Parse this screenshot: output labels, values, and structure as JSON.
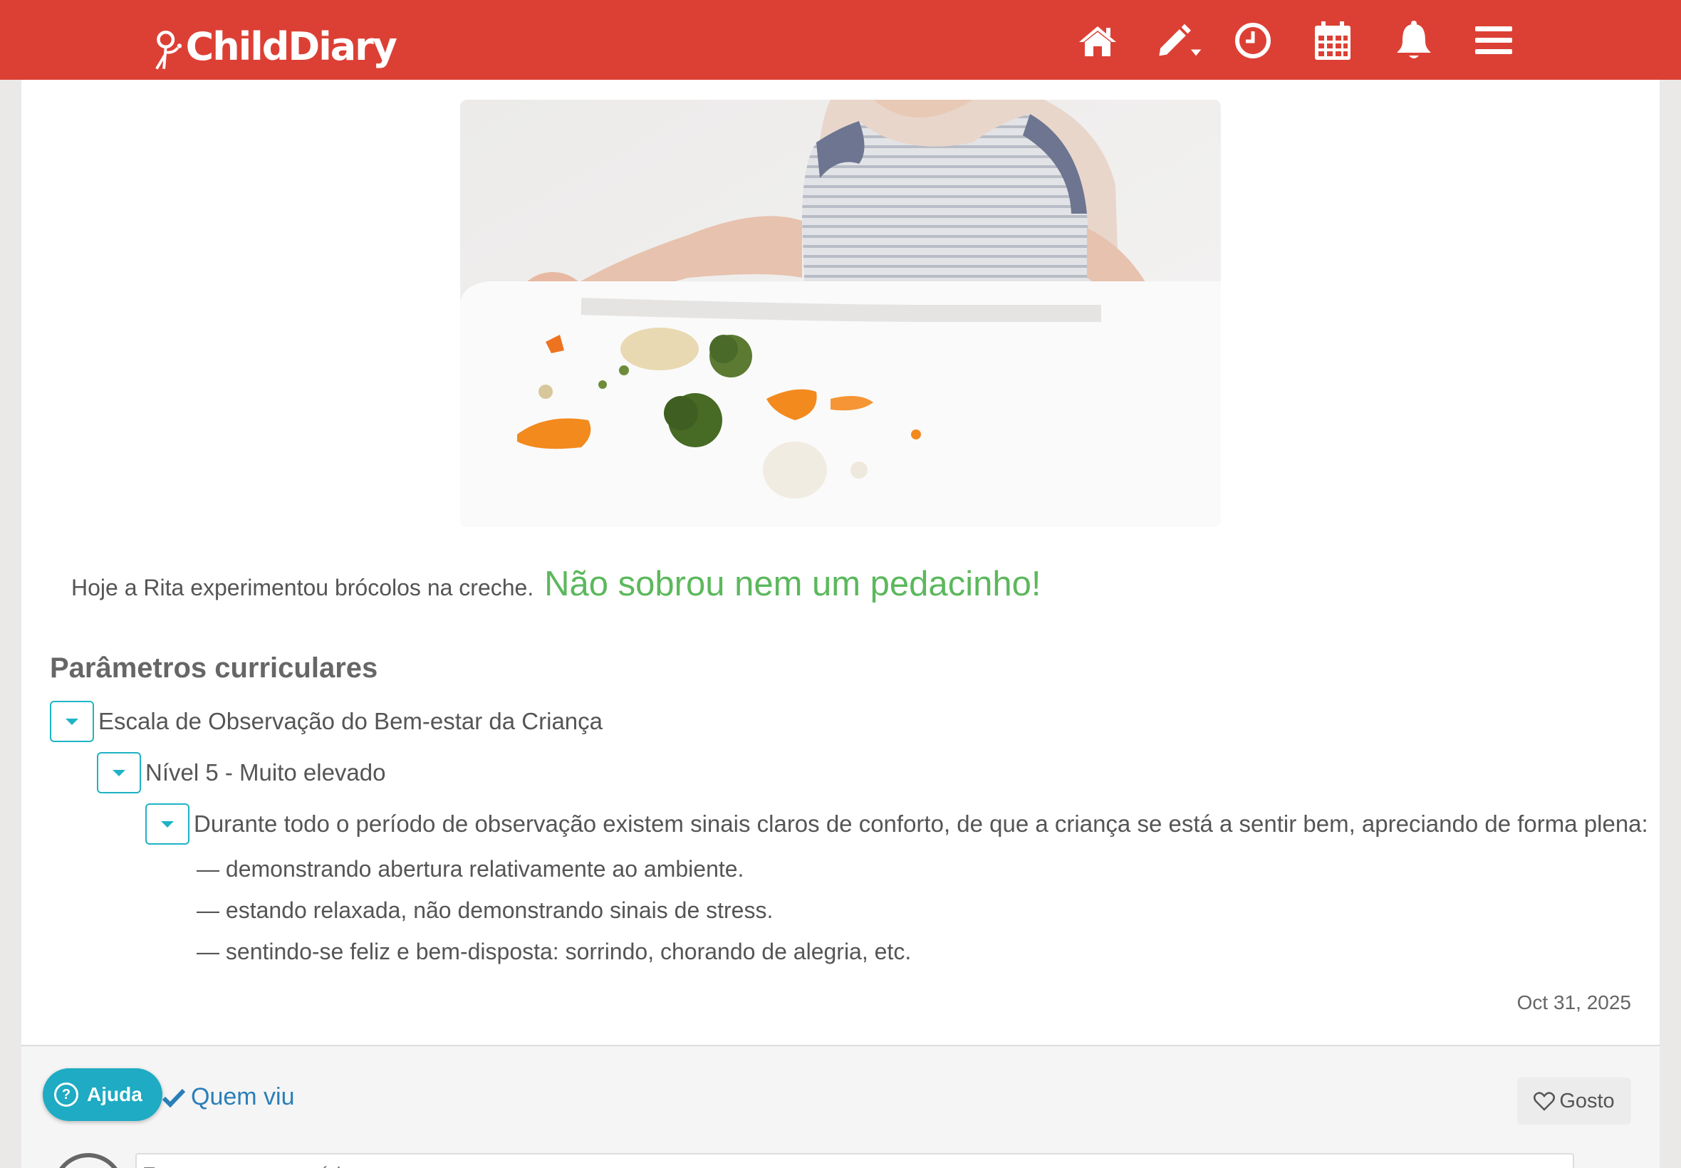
{
  "header": {
    "logo_text": "ChildDiary",
    "nav_icons": [
      "home-icon",
      "edit-icon",
      "clock-icon",
      "calendar-icon",
      "bell-icon",
      "menu-icon"
    ]
  },
  "post": {
    "caption_text": "Hoje a Rita experimentou brócolos na creche.",
    "caption_highlight": "Não sobrou nem um pedacinho!",
    "section_title": "Parâmetros curriculares",
    "tree": {
      "level1": "Escala de Observação do Bem-estar da Criança",
      "level2": "Nível 5 - Muito elevado",
      "level3": "Durante todo o período de observação existem sinais claros de conforto, de que a criança se está a sentir bem, apreciando de forma plena:",
      "items": [
        "— demonstrando abertura relativamente ao ambiente.",
        "— estando relaxada, não demonstrando sinais de stress.",
        "— sentindo-se feliz e bem-disposta: sorrindo, chorando de alegria, etc."
      ]
    },
    "date": "Oct 31, 2025"
  },
  "footer": {
    "quem_viu": "Quem viu",
    "gosto": "Gosto",
    "comment_placeholder": "Escreva um comentário"
  },
  "help": {
    "label": "Ajuda"
  },
  "colors": {
    "header": "#dc4035",
    "highlight": "#5cb85c",
    "accent": "#1eb3c5",
    "link": "#2a7fb8"
  }
}
